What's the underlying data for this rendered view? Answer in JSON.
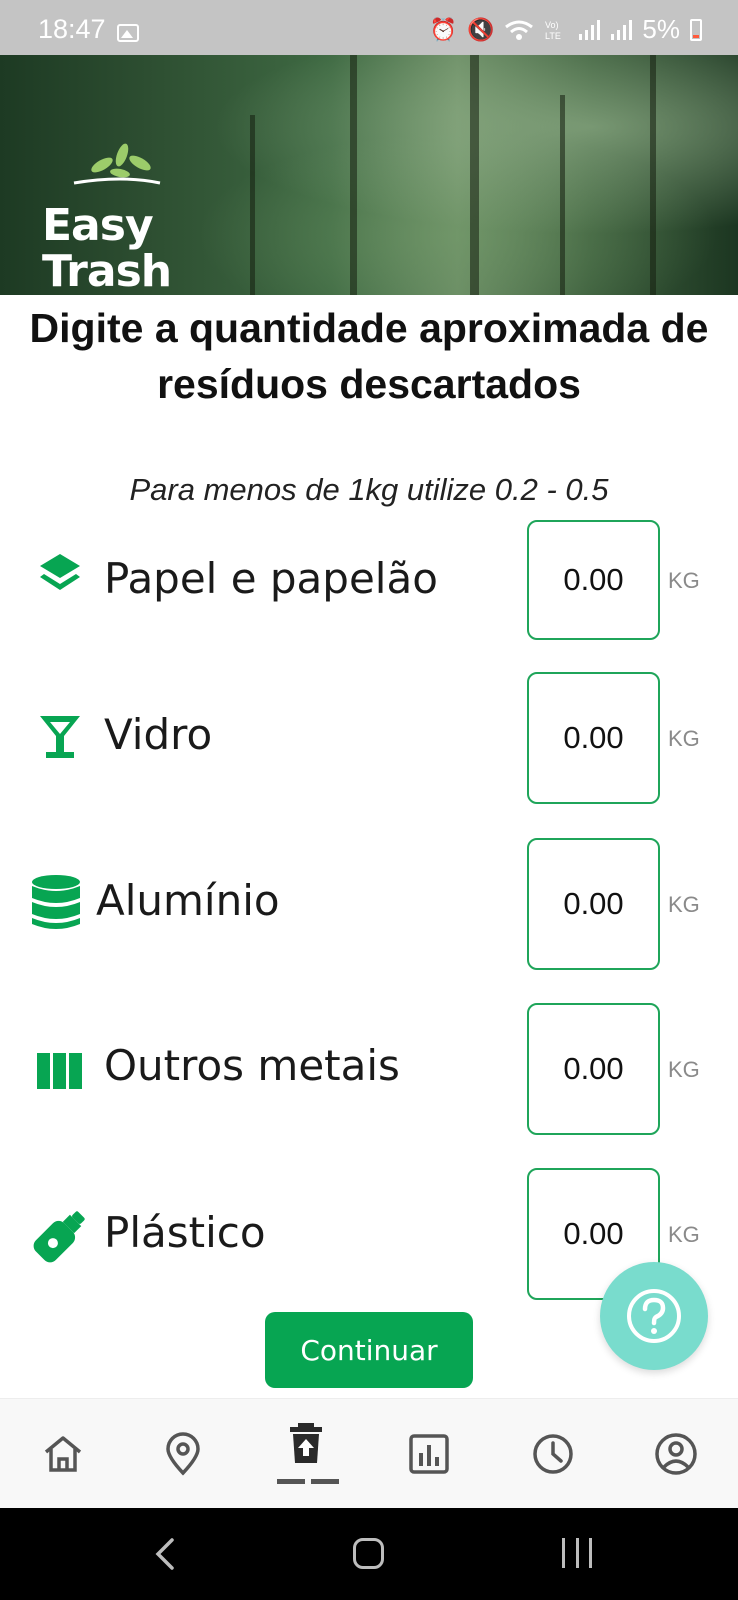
{
  "status_bar": {
    "time": "18:47",
    "battery": "5%",
    "icons": [
      "gallery-icon",
      "alarm-icon",
      "mute-icon",
      "wifi-icon",
      "volte-icon",
      "signal-icon",
      "signal-icon",
      "battery-icon"
    ]
  },
  "header": {
    "logo_line1": "Easy",
    "logo_line2": "Trash",
    "background": "forest-image"
  },
  "main": {
    "title": "Digite a quantidade aproximada de resíduos descartados",
    "subtitle": "Para menos de 1kg utilize 0.2 - 0.5",
    "materials": [
      {
        "label": "Papel e papelão",
        "value": "0.00",
        "unit": "KG",
        "icon": "layers-icon"
      },
      {
        "label": "Vidro",
        "value": "0.00",
        "unit": "KG",
        "icon": "glass-icon"
      },
      {
        "label": "Alumínio",
        "value": "0.00",
        "unit": "KG",
        "icon": "database-icon"
      },
      {
        "label": "Outros metais",
        "value": "0.00",
        "unit": "KG",
        "icon": "columns-icon"
      },
      {
        "label": "Plástico",
        "value": "0.00",
        "unit": "KG",
        "icon": "bottle-icon"
      }
    ],
    "continue_label": "Continuar"
  },
  "help_button": {
    "icon": "question-icon"
  },
  "bottom_nav": {
    "items": [
      {
        "icon": "home-icon",
        "active": false
      },
      {
        "icon": "location-icon",
        "active": false
      },
      {
        "icon": "trash-upload-icon",
        "active": true
      },
      {
        "icon": "chart-icon",
        "active": false
      },
      {
        "icon": "clock-icon",
        "active": false
      },
      {
        "icon": "profile-icon",
        "active": false
      }
    ]
  },
  "colors": {
    "accent": "#07a552",
    "input_border": "#1fa55a",
    "help_fab": "#79dccd",
    "status_bar": "#c4c4c4"
  }
}
